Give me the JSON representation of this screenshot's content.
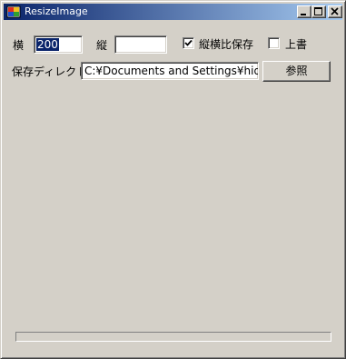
{
  "window": {
    "title": "ResizeImage",
    "icon": "app-icon"
  },
  "form": {
    "width_label": "横",
    "width_value": "200",
    "height_label": "縦",
    "height_value": "",
    "keep_aspect_label": "縦横比保存",
    "keep_aspect_checked": true,
    "overwrite_label": "上書",
    "overwrite_checked": false,
    "save_dir_label": "保存ディレクトリ",
    "save_dir_value": "C:¥Documents and Settings¥hide¥デ",
    "browse_label": "参照"
  },
  "progress": {
    "value": 0
  },
  "colors": {
    "face": "#d4d0c8",
    "title_start": "#0a246a",
    "title_end": "#a6caf0",
    "selection": "#0a246a"
  }
}
